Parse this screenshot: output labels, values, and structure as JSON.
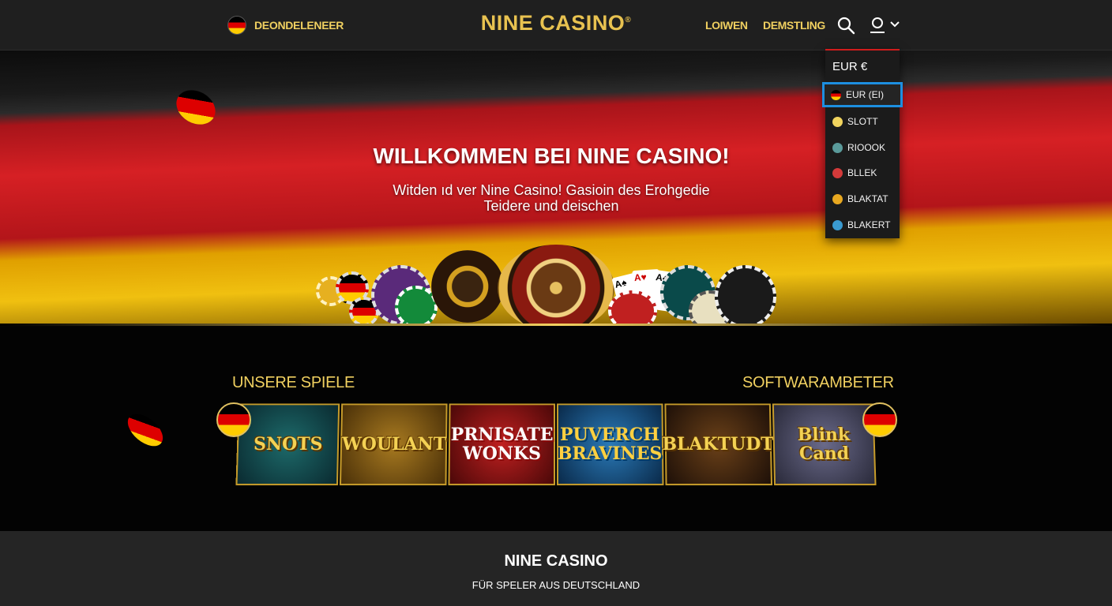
{
  "header": {
    "language_label": "DEONDELENEER",
    "logo": "NINE CASINO",
    "logo_mark": "®",
    "nav": {
      "login": "LOIWEN",
      "register": "DEMSTLING"
    }
  },
  "currency_dropdown": {
    "heading": "EUR €",
    "items": [
      {
        "label": "EUR (EI)",
        "icon": "german-flag-icon",
        "color": "#e0a000",
        "selected": true
      },
      {
        "label": "SLOTT",
        "icon": "coin-icon",
        "color": "#f1d45e"
      },
      {
        "label": "RIOOOK",
        "icon": "chip-icon",
        "color": "#5a9a9a"
      },
      {
        "label": "BLLEK",
        "icon": "chip-icon",
        "color": "#d43a3a"
      },
      {
        "label": "BLAKTAT",
        "icon": "coin-icon",
        "color": "#e8a820"
      },
      {
        "label": "BLAKERT",
        "icon": "chip-icon",
        "color": "#3a9ad0"
      }
    ]
  },
  "hero": {
    "title": "WILLKOMMEN BEI NINE CASINO!",
    "subtitle_line1": "Witden ıd ver Nine Casino! Gasioin des Erohgedie",
    "subtitle_line2": "Teidere und deischen"
  },
  "games": {
    "left_label": "UNSERE SPIELE",
    "right_label": "SOFTWARAMBETER",
    "tiles": [
      {
        "title": "SNOTS"
      },
      {
        "title": "WOULANT"
      },
      {
        "title": "PRNISATE WONKS"
      },
      {
        "title": "PUVERCH BRAVINES"
      },
      {
        "title": "BLAKTUDT"
      },
      {
        "title": "Blink Cand"
      }
    ]
  },
  "footer": {
    "title": "NINE CASINO",
    "subtitle": "FÜR SPELER AUS DEUTSCHLAND"
  },
  "colors": {
    "accent_gold": "#f0d060",
    "flag_red": "#d62024",
    "flag_gold": "#f0c010",
    "selection_blue": "#1d8fe0"
  }
}
